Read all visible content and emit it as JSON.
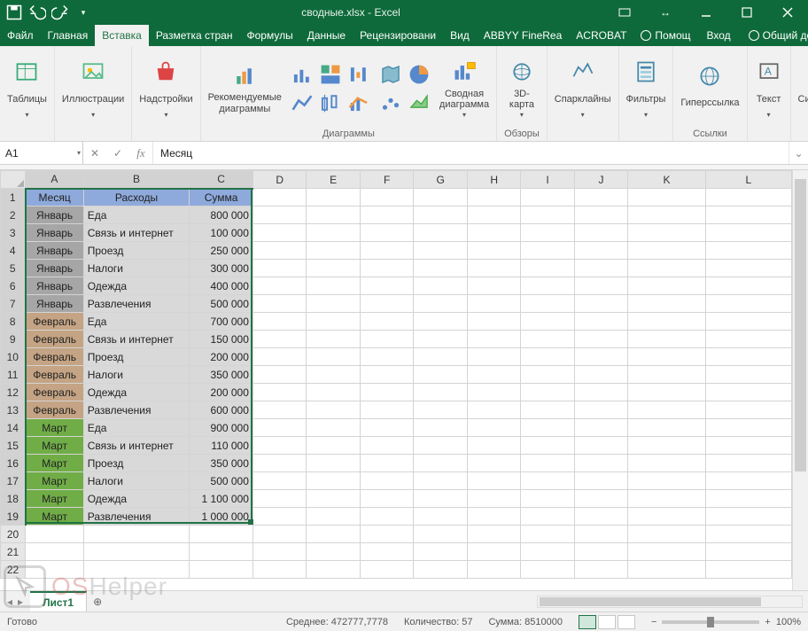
{
  "title": "сводные.xlsx - Excel",
  "qat": {
    "save": "Сохранить",
    "undo": "Отменить",
    "redo": "Повторить"
  },
  "tabs": {
    "file": "Файл",
    "home": "Главная",
    "insert": "Вставка",
    "layout": "Разметка стран",
    "formulas": "Формулы",
    "data": "Данные",
    "review": "Рецензировани",
    "view": "Вид",
    "abbyy": "ABBYY FineRea",
    "acrobat": "ACROBAT",
    "tellme": "Помощ",
    "signin": "Вход",
    "share": "Общий доступ"
  },
  "ribbon": {
    "tables": "Таблицы",
    "illustrations": "Иллюстрации",
    "addins": "Надстройки",
    "reccharts": "Рекомендуемые\nдиаграммы",
    "chartsgroup": "Диаграммы",
    "pivotchart": "Сводная\nдиаграмма",
    "map3d": "3D-\nкарта",
    "tours": "Обзоры",
    "sparklines": "Спарклайны",
    "filters": "Фильтры",
    "hyperlink": "Гиперссылка",
    "links": "Ссылки",
    "text": "Текст",
    "symbols": "Символы"
  },
  "namebox": "A1",
  "formula": "Месяц",
  "columns": [
    "A",
    "B",
    "C",
    "D",
    "E",
    "F",
    "G",
    "H",
    "I",
    "J",
    "K",
    "L"
  ],
  "rownums": [
    1,
    2,
    3,
    4,
    5,
    6,
    7,
    8,
    9,
    10,
    11,
    12,
    13,
    14,
    15,
    16,
    17,
    18,
    19,
    20,
    21,
    22
  ],
  "headers": {
    "month": "Месяц",
    "expense": "Расходы",
    "sum": "Сумма"
  },
  "rows": [
    {
      "m": "Январь",
      "e": "Еда",
      "s": "800 000",
      "c": "m1"
    },
    {
      "m": "Январь",
      "e": "Связь и интернет",
      "s": "100 000",
      "c": "m1"
    },
    {
      "m": "Январь",
      "e": "Проезд",
      "s": "250 000",
      "c": "m1"
    },
    {
      "m": "Январь",
      "e": "Налоги",
      "s": "300 000",
      "c": "m1"
    },
    {
      "m": "Январь",
      "e": "Одежда",
      "s": "400 000",
      "c": "m1"
    },
    {
      "m": "Январь",
      "e": "Развлечения",
      "s": "500 000",
      "c": "m1"
    },
    {
      "m": "Февраль",
      "e": "Еда",
      "s": "700 000",
      "c": "m2"
    },
    {
      "m": "Февраль",
      "e": "Связь и интернет",
      "s": "150 000",
      "c": "m2"
    },
    {
      "m": "Февраль",
      "e": "Проезд",
      "s": "200 000",
      "c": "m2"
    },
    {
      "m": "Февраль",
      "e": "Налоги",
      "s": "350 000",
      "c": "m2"
    },
    {
      "m": "Февраль",
      "e": "Одежда",
      "s": "200 000",
      "c": "m2"
    },
    {
      "m": "Февраль",
      "e": "Развлечения",
      "s": "600 000",
      "c": "m2"
    },
    {
      "m": "Март",
      "e": "Еда",
      "s": "900 000",
      "c": "m3"
    },
    {
      "m": "Март",
      "e": "Связь и интернет",
      "s": "110 000",
      "c": "m3"
    },
    {
      "m": "Март",
      "e": "Проезд",
      "s": "350 000",
      "c": "m3"
    },
    {
      "m": "Март",
      "e": "Налоги",
      "s": "500 000",
      "c": "m3"
    },
    {
      "m": "Март",
      "e": "Одежда",
      "s": "1 100 000",
      "c": "m3"
    },
    {
      "m": "Март",
      "e": "Развлечения",
      "s": "1 000 000",
      "c": "m3"
    }
  ],
  "sheet_tab": "Лист1",
  "status": {
    "ready": "Готово",
    "avg_label": "Среднее:",
    "avg_val": "472777,7778",
    "count_label": "Количество:",
    "count_val": "57",
    "sum_label": "Сумма:",
    "sum_val": "8510000",
    "zoom": "100%"
  },
  "watermark": {
    "a": "OS",
    "b": "Helper"
  },
  "chart_data": {
    "type": "table",
    "columns": [
      "Месяц",
      "Расходы",
      "Сумма"
    ],
    "rows": [
      [
        "Январь",
        "Еда",
        800000
      ],
      [
        "Январь",
        "Связь и интернет",
        100000
      ],
      [
        "Январь",
        "Проезд",
        250000
      ],
      [
        "Январь",
        "Налоги",
        300000
      ],
      [
        "Январь",
        "Одежда",
        400000
      ],
      [
        "Январь",
        "Развлечения",
        500000
      ],
      [
        "Февраль",
        "Еда",
        700000
      ],
      [
        "Февраль",
        "Связь и интернет",
        150000
      ],
      [
        "Февраль",
        "Проезд",
        200000
      ],
      [
        "Февраль",
        "Налоги",
        350000
      ],
      [
        "Февраль",
        "Одежда",
        200000
      ],
      [
        "Февраль",
        "Развлечения",
        600000
      ],
      [
        "Март",
        "Еда",
        900000
      ],
      [
        "Март",
        "Связь и интернет",
        110000
      ],
      [
        "Март",
        "Проезд",
        350000
      ],
      [
        "Март",
        "Налоги",
        500000
      ],
      [
        "Март",
        "Одежда",
        1100000
      ],
      [
        "Март",
        "Развлечения",
        1000000
      ]
    ],
    "aggregates": {
      "average": 472777.7778,
      "count": 57,
      "sum": 8510000
    }
  }
}
